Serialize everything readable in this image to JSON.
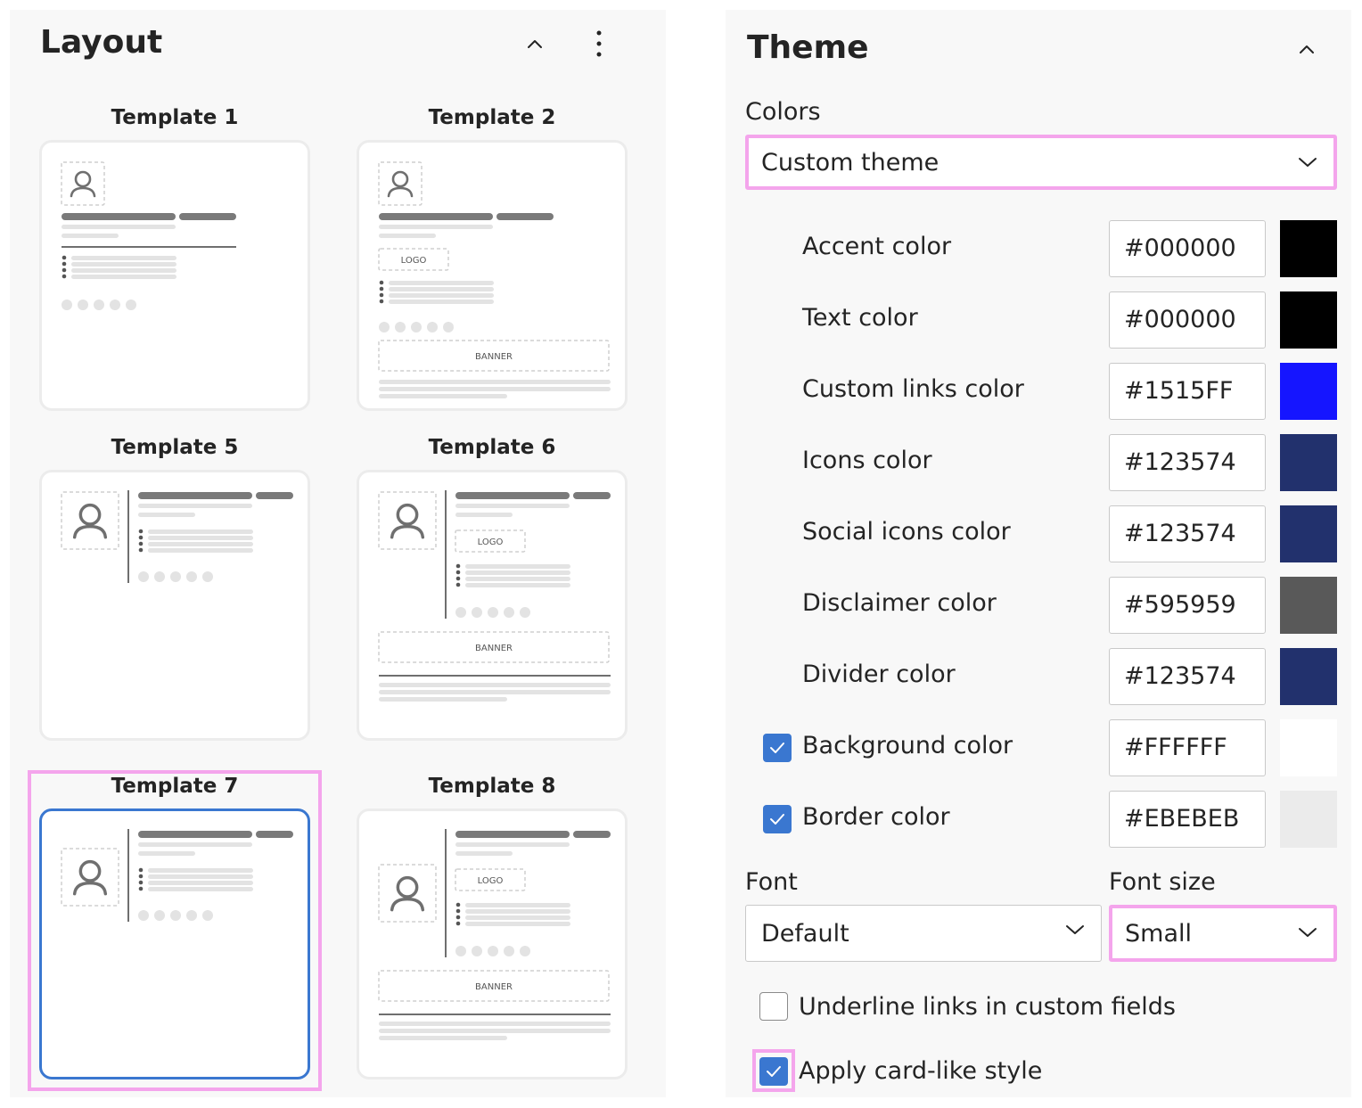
{
  "layout": {
    "title": "Layout",
    "templates": [
      {
        "label": "Template 1",
        "variant": "t1",
        "selected": false
      },
      {
        "label": "Template 2",
        "variant": "t2",
        "selected": false
      },
      {
        "label": "Template 5",
        "variant": "t5",
        "selected": false
      },
      {
        "label": "Template 6",
        "variant": "t6",
        "selected": false
      },
      {
        "label": "Template 7",
        "variant": "t7",
        "selected": true
      },
      {
        "label": "Template 8",
        "variant": "t8",
        "selected": false
      }
    ],
    "thumb_logo_text": "LOGO",
    "thumb_banner_text": "BANNER"
  },
  "theme": {
    "title": "Theme",
    "colors_label": "Colors",
    "colors_select_value": "Custom theme",
    "color_rows": [
      {
        "label": "Accent color",
        "value": "#000000",
        "swatch": "#000000",
        "checkbox": null
      },
      {
        "label": "Text color",
        "value": "#000000",
        "swatch": "#000000",
        "checkbox": null
      },
      {
        "label": "Custom links color",
        "value": "#1515FF",
        "swatch": "#1515FF",
        "checkbox": null
      },
      {
        "label": "Icons color",
        "value": "#123574",
        "swatch": "#22316D",
        "checkbox": null
      },
      {
        "label": "Social icons color",
        "value": "#123574",
        "swatch": "#22316D",
        "checkbox": null
      },
      {
        "label": "Disclaimer color",
        "value": "#595959",
        "swatch": "#595959",
        "checkbox": null
      },
      {
        "label": "Divider color",
        "value": "#123574",
        "swatch": "#22316D",
        "checkbox": null
      },
      {
        "label": "Background color",
        "value": "#FFFFFF",
        "swatch": "#FFFFFF",
        "checkbox": true
      },
      {
        "label": "Border color",
        "value": "#EBEBEB",
        "swatch": "#EBEBEB",
        "checkbox": true
      }
    ],
    "font_label": "Font",
    "font_value": "Default",
    "font_size_label": "Font size",
    "font_size_value": "Small",
    "underline_label": "Underline links in custom fields",
    "underline_checked": false,
    "card_style_label": "Apply card-like style",
    "card_style_checked": true
  },
  "colors": {
    "accent": "#3a77d0",
    "highlight": "#f4a5ec",
    "thumb_bar": "#7a7a7a",
    "thumb_line": "#e3e3e3"
  },
  "icons": {
    "collapse": "chevron-up-icon",
    "more": "more-vertical-icon",
    "dropdown": "chevron-down-icon",
    "check": "checkmark-icon",
    "avatar": "person-icon"
  }
}
